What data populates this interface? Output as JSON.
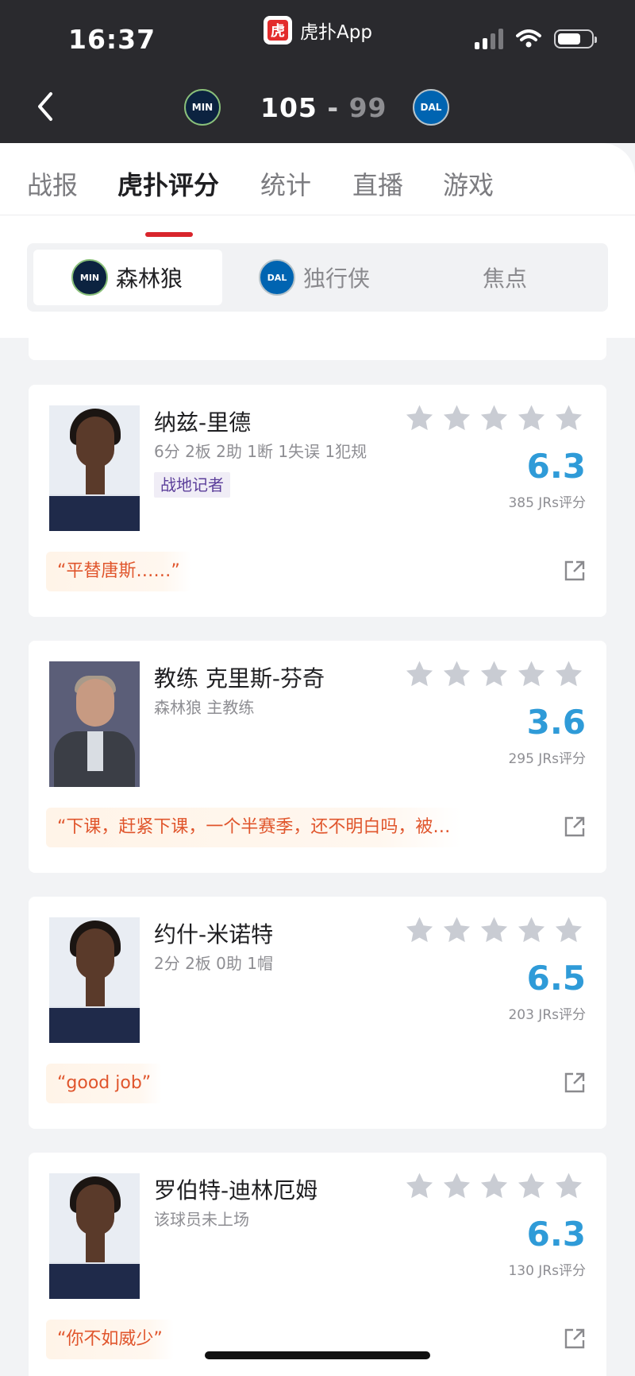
{
  "status_bar": {
    "time": "16:37",
    "app_name": "虎扑App"
  },
  "header": {
    "home_team_logo": "MIN",
    "away_team_logo": "DAL",
    "home_score": "105",
    "separator": "-",
    "away_score": "99"
  },
  "tabs": [
    "战报",
    "虎扑评分",
    "统计",
    "直播",
    "游戏"
  ],
  "active_tab": "虎扑评分",
  "segments": [
    {
      "logo": "MIN",
      "label": "森林狼"
    },
    {
      "logo": "DAL",
      "label": "独行侠"
    },
    {
      "label": "焦点"
    }
  ],
  "players": [
    {
      "name": "纳兹-里德",
      "sub": "6分 2板 2助 1断 1失误 1犯规",
      "tag": "战地记者",
      "score": "6.3",
      "votes": "385 JRs评分",
      "quote": "“平替唐斯……”"
    },
    {
      "name": "教练 克里斯-芬奇",
      "sub": "森林狼 主教练",
      "score": "3.6",
      "votes": "295 JRs评分",
      "quote": "“下课，赶紧下课，一个半赛季，还不明白吗，被…"
    },
    {
      "name": "约什-米诺特",
      "sub": "2分 2板 0助 1帽",
      "score": "6.5",
      "votes": "203 JRs评分",
      "quote": "“good job”"
    },
    {
      "name": "罗伯特-迪林厄姆",
      "sub": "该球员未上场",
      "score": "6.3",
      "votes": "130 JRs评分",
      "quote": "“你不如威少”"
    }
  ],
  "colors": {
    "accent": "#d9252c",
    "score": "#2f9bd8",
    "quote": "#e0552c"
  }
}
